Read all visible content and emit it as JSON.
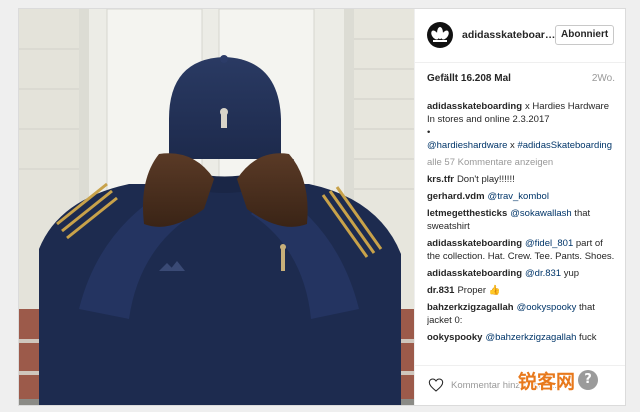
{
  "post": {
    "username": "adidasskateboarding",
    "follow_label": "Abonniert",
    "likes": "Gefällt 16.208 Mal",
    "age": "2Wo."
  },
  "comments": [
    {
      "user": "adidasskateboarding",
      "parts": [
        {
          "type": "text",
          "value": "x Hardies Hardware"
        },
        {
          "type": "br"
        },
        {
          "type": "text",
          "value": "In stores and online 2.3.2017"
        },
        {
          "type": "br"
        },
        {
          "type": "text",
          "value": "•"
        },
        {
          "type": "br"
        },
        {
          "type": "mention",
          "value": "@hardieshardware"
        },
        {
          "type": "text",
          "value": " x "
        },
        {
          "type": "mention",
          "value": "#adidasSkateboarding"
        }
      ]
    },
    {
      "view_all": "alle 57 Kommentare anzeigen"
    },
    {
      "user": "krs.tfr",
      "parts": [
        {
          "type": "text",
          "value": "Don't play!!!!!!"
        }
      ]
    },
    {
      "user": "gerhard.vdm",
      "parts": [
        {
          "type": "mention",
          "value": "@trav_kombol"
        }
      ]
    },
    {
      "user": "letmegetthesticks",
      "parts": [
        {
          "type": "mention",
          "value": "@sokawallash"
        },
        {
          "type": "text",
          "value": " that sweatshirt"
        }
      ]
    },
    {
      "user": "adidasskateboarding",
      "parts": [
        {
          "type": "mention",
          "value": "@fidel_801"
        },
        {
          "type": "text",
          "value": " part of the collection. Hat. Crew. Tee. Pants. Shoes."
        }
      ]
    },
    {
      "user": "adidasskateboarding",
      "parts": [
        {
          "type": "mention",
          "value": "@dr.831"
        },
        {
          "type": "text",
          "value": " yup"
        }
      ]
    },
    {
      "user": "dr.831",
      "parts": [
        {
          "type": "text",
          "value": "Proper 👍"
        }
      ]
    },
    {
      "user": "bahzerkzigzagallah",
      "parts": [
        {
          "type": "mention",
          "value": "@ookyspooky"
        },
        {
          "type": "text",
          "value": " that jacket 0:"
        }
      ]
    },
    {
      "user": "ookyspooky",
      "parts": [
        {
          "type": "mention",
          "value": "@bahzerkzigzagallah"
        },
        {
          "type": "text",
          "value": " fuck"
        }
      ]
    }
  ],
  "add_comment": {
    "placeholder": "Kommentar hinzufügen..."
  },
  "icons": {
    "like": "heart-icon",
    "avatar": "adidas-trefoil-logo"
  },
  "watermark": {
    "text": "锐客网",
    "icon": "?"
  },
  "colors": {
    "link": "#003569",
    "muted": "#999999",
    "text": "#262626",
    "navy": "#1c2a4a",
    "stripe": "#c8a24a",
    "watermark": "#e8791c"
  }
}
